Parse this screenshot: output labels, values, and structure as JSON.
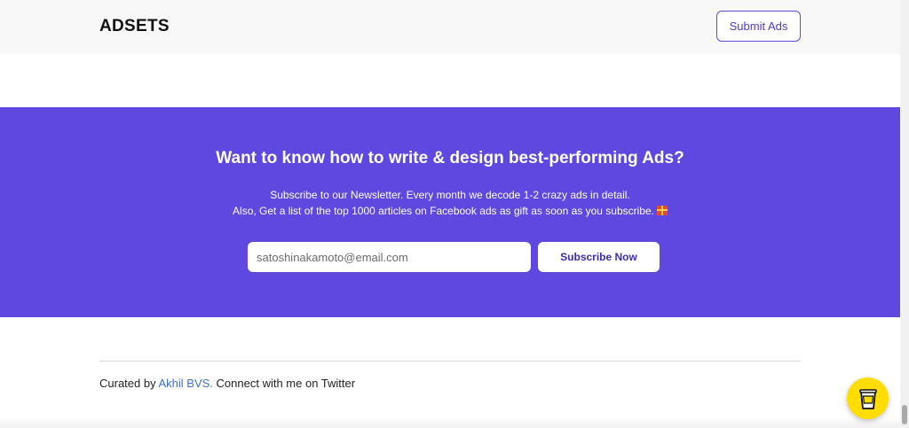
{
  "header": {
    "logo": "ADSETS",
    "submit_label": "Submit Ads"
  },
  "newsletter": {
    "heading": "Want to know how to write & design best-performing Ads?",
    "line1": "Subscribe to our Newsletter. Every month we decode 1-2 crazy ads in detail.",
    "line2": "Also, Get a list of the top 1000 articles on Facebook ads as gift as soon as you subscribe.",
    "line2_icon": "gift-icon",
    "email_placeholder": "satoshinakamoto@email.com",
    "subscribe_label": "Subscribe Now"
  },
  "footer": {
    "prefix": "Curated by ",
    "author": "Akhil BVS.",
    "suffix": " Connect with me on Twitter"
  },
  "widget": {
    "icon": "coffee-cup-icon"
  },
  "colors": {
    "accent": "#5e48e0",
    "link": "#3d6fd0",
    "widget": "#ffdd00"
  }
}
